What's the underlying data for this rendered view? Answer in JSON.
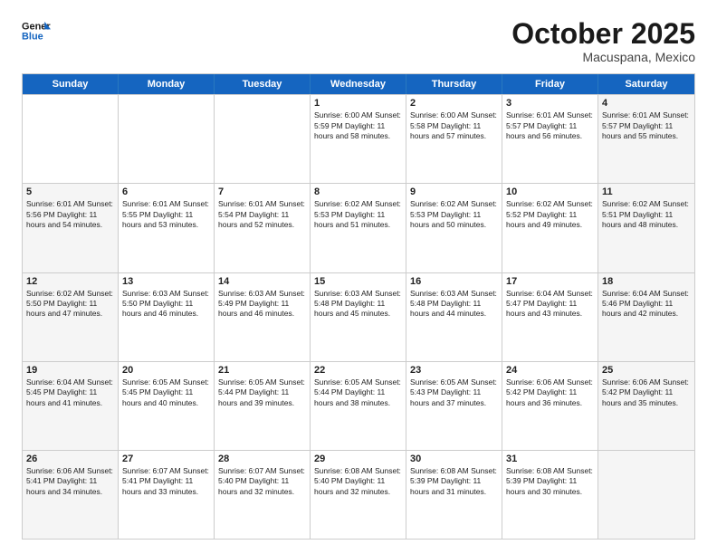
{
  "header": {
    "logo_general": "General",
    "logo_blue": "Blue",
    "month": "October 2025",
    "location": "Macuspana, Mexico"
  },
  "weekdays": [
    "Sunday",
    "Monday",
    "Tuesday",
    "Wednesday",
    "Thursday",
    "Friday",
    "Saturday"
  ],
  "weeks": [
    [
      {
        "day": "",
        "text": "",
        "shaded": false
      },
      {
        "day": "",
        "text": "",
        "shaded": false
      },
      {
        "day": "",
        "text": "",
        "shaded": false
      },
      {
        "day": "1",
        "text": "Sunrise: 6:00 AM\nSunset: 5:59 PM\nDaylight: 11 hours\nand 58 minutes.",
        "shaded": false
      },
      {
        "day": "2",
        "text": "Sunrise: 6:00 AM\nSunset: 5:58 PM\nDaylight: 11 hours\nand 57 minutes.",
        "shaded": false
      },
      {
        "day": "3",
        "text": "Sunrise: 6:01 AM\nSunset: 5:57 PM\nDaylight: 11 hours\nand 56 minutes.",
        "shaded": false
      },
      {
        "day": "4",
        "text": "Sunrise: 6:01 AM\nSunset: 5:57 PM\nDaylight: 11 hours\nand 55 minutes.",
        "shaded": true
      }
    ],
    [
      {
        "day": "5",
        "text": "Sunrise: 6:01 AM\nSunset: 5:56 PM\nDaylight: 11 hours\nand 54 minutes.",
        "shaded": true
      },
      {
        "day": "6",
        "text": "Sunrise: 6:01 AM\nSunset: 5:55 PM\nDaylight: 11 hours\nand 53 minutes.",
        "shaded": false
      },
      {
        "day": "7",
        "text": "Sunrise: 6:01 AM\nSunset: 5:54 PM\nDaylight: 11 hours\nand 52 minutes.",
        "shaded": false
      },
      {
        "day": "8",
        "text": "Sunrise: 6:02 AM\nSunset: 5:53 PM\nDaylight: 11 hours\nand 51 minutes.",
        "shaded": false
      },
      {
        "day": "9",
        "text": "Sunrise: 6:02 AM\nSunset: 5:53 PM\nDaylight: 11 hours\nand 50 minutes.",
        "shaded": false
      },
      {
        "day": "10",
        "text": "Sunrise: 6:02 AM\nSunset: 5:52 PM\nDaylight: 11 hours\nand 49 minutes.",
        "shaded": false
      },
      {
        "day": "11",
        "text": "Sunrise: 6:02 AM\nSunset: 5:51 PM\nDaylight: 11 hours\nand 48 minutes.",
        "shaded": true
      }
    ],
    [
      {
        "day": "12",
        "text": "Sunrise: 6:02 AM\nSunset: 5:50 PM\nDaylight: 11 hours\nand 47 minutes.",
        "shaded": true
      },
      {
        "day": "13",
        "text": "Sunrise: 6:03 AM\nSunset: 5:50 PM\nDaylight: 11 hours\nand 46 minutes.",
        "shaded": false
      },
      {
        "day": "14",
        "text": "Sunrise: 6:03 AM\nSunset: 5:49 PM\nDaylight: 11 hours\nand 46 minutes.",
        "shaded": false
      },
      {
        "day": "15",
        "text": "Sunrise: 6:03 AM\nSunset: 5:48 PM\nDaylight: 11 hours\nand 45 minutes.",
        "shaded": false
      },
      {
        "day": "16",
        "text": "Sunrise: 6:03 AM\nSunset: 5:48 PM\nDaylight: 11 hours\nand 44 minutes.",
        "shaded": false
      },
      {
        "day": "17",
        "text": "Sunrise: 6:04 AM\nSunset: 5:47 PM\nDaylight: 11 hours\nand 43 minutes.",
        "shaded": false
      },
      {
        "day": "18",
        "text": "Sunrise: 6:04 AM\nSunset: 5:46 PM\nDaylight: 11 hours\nand 42 minutes.",
        "shaded": true
      }
    ],
    [
      {
        "day": "19",
        "text": "Sunrise: 6:04 AM\nSunset: 5:45 PM\nDaylight: 11 hours\nand 41 minutes.",
        "shaded": true
      },
      {
        "day": "20",
        "text": "Sunrise: 6:05 AM\nSunset: 5:45 PM\nDaylight: 11 hours\nand 40 minutes.",
        "shaded": false
      },
      {
        "day": "21",
        "text": "Sunrise: 6:05 AM\nSunset: 5:44 PM\nDaylight: 11 hours\nand 39 minutes.",
        "shaded": false
      },
      {
        "day": "22",
        "text": "Sunrise: 6:05 AM\nSunset: 5:44 PM\nDaylight: 11 hours\nand 38 minutes.",
        "shaded": false
      },
      {
        "day": "23",
        "text": "Sunrise: 6:05 AM\nSunset: 5:43 PM\nDaylight: 11 hours\nand 37 minutes.",
        "shaded": false
      },
      {
        "day": "24",
        "text": "Sunrise: 6:06 AM\nSunset: 5:42 PM\nDaylight: 11 hours\nand 36 minutes.",
        "shaded": false
      },
      {
        "day": "25",
        "text": "Sunrise: 6:06 AM\nSunset: 5:42 PM\nDaylight: 11 hours\nand 35 minutes.",
        "shaded": true
      }
    ],
    [
      {
        "day": "26",
        "text": "Sunrise: 6:06 AM\nSunset: 5:41 PM\nDaylight: 11 hours\nand 34 minutes.",
        "shaded": true
      },
      {
        "day": "27",
        "text": "Sunrise: 6:07 AM\nSunset: 5:41 PM\nDaylight: 11 hours\nand 33 minutes.",
        "shaded": false
      },
      {
        "day": "28",
        "text": "Sunrise: 6:07 AM\nSunset: 5:40 PM\nDaylight: 11 hours\nand 32 minutes.",
        "shaded": false
      },
      {
        "day": "29",
        "text": "Sunrise: 6:08 AM\nSunset: 5:40 PM\nDaylight: 11 hours\nand 32 minutes.",
        "shaded": false
      },
      {
        "day": "30",
        "text": "Sunrise: 6:08 AM\nSunset: 5:39 PM\nDaylight: 11 hours\nand 31 minutes.",
        "shaded": false
      },
      {
        "day": "31",
        "text": "Sunrise: 6:08 AM\nSunset: 5:39 PM\nDaylight: 11 hours\nand 30 minutes.",
        "shaded": false
      },
      {
        "day": "",
        "text": "",
        "shaded": true
      }
    ]
  ]
}
